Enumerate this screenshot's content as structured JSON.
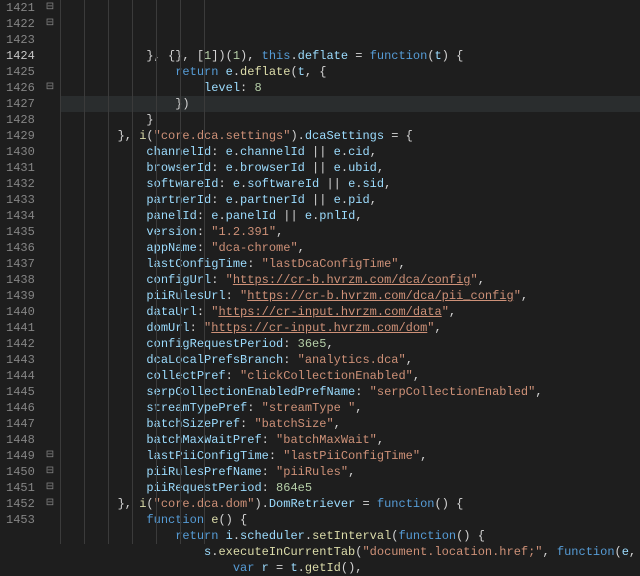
{
  "editor": {
    "currentLine": 1424,
    "indentWidth": 24,
    "lines": [
      {
        "num": 1421,
        "fold": "open",
        "indent": 3,
        "tokens": [
          [
            "p",
            "}, {}, ["
          ],
          [
            "n",
            "1"
          ],
          [
            "p",
            "])("
          ],
          [
            "n",
            "1"
          ],
          [
            "p",
            "), "
          ],
          [
            "k",
            "this"
          ],
          [
            "p",
            "."
          ],
          [
            "i",
            "deflate"
          ],
          [
            "p",
            " = "
          ],
          [
            "k",
            "function"
          ],
          [
            "p",
            "("
          ],
          [
            "i",
            "t"
          ],
          [
            "p",
            ") {"
          ]
        ]
      },
      {
        "num": 1422,
        "fold": "open",
        "indent": 4,
        "tokens": [
          [
            "k",
            "return"
          ],
          [
            "p",
            " "
          ],
          [
            "i",
            "e"
          ],
          [
            "p",
            "."
          ],
          [
            "f",
            "deflate"
          ],
          [
            "p",
            "("
          ],
          [
            "i",
            "t"
          ],
          [
            "p",
            ", {"
          ]
        ]
      },
      {
        "num": 1423,
        "fold": "",
        "indent": 5,
        "tokens": [
          [
            "i",
            "level"
          ],
          [
            "p",
            ": "
          ],
          [
            "n",
            "8"
          ]
        ]
      },
      {
        "num": 1424,
        "fold": "",
        "indent": 4,
        "tokens": [
          [
            "p",
            "})"
          ]
        ]
      },
      {
        "num": 1425,
        "fold": "",
        "indent": 3,
        "tokens": [
          [
            "p",
            "}"
          ]
        ]
      },
      {
        "num": 1426,
        "fold": "open",
        "indent": 2,
        "tokens": [
          [
            "p",
            "}, "
          ],
          [
            "f",
            "i"
          ],
          [
            "p",
            "("
          ],
          [
            "s",
            "\"core.dca.settings\""
          ],
          [
            "p",
            ")."
          ],
          [
            "i",
            "dcaSettings"
          ],
          [
            "p",
            " = {"
          ]
        ]
      },
      {
        "num": 1427,
        "fold": "",
        "indent": 3,
        "tokens": [
          [
            "i",
            "channelId"
          ],
          [
            "p",
            ": "
          ],
          [
            "i",
            "e"
          ],
          [
            "p",
            "."
          ],
          [
            "i",
            "channelId"
          ],
          [
            "p",
            " || "
          ],
          [
            "i",
            "e"
          ],
          [
            "p",
            "."
          ],
          [
            "i",
            "cid"
          ],
          [
            "p",
            ","
          ]
        ]
      },
      {
        "num": 1428,
        "fold": "",
        "indent": 3,
        "tokens": [
          [
            "i",
            "browserId"
          ],
          [
            "p",
            ": "
          ],
          [
            "i",
            "e"
          ],
          [
            "p",
            "."
          ],
          [
            "i",
            "browserId"
          ],
          [
            "p",
            " || "
          ],
          [
            "i",
            "e"
          ],
          [
            "p",
            "."
          ],
          [
            "i",
            "ubid"
          ],
          [
            "p",
            ","
          ]
        ]
      },
      {
        "num": 1429,
        "fold": "",
        "indent": 3,
        "tokens": [
          [
            "i",
            "softwareId"
          ],
          [
            "p",
            ": "
          ],
          [
            "i",
            "e"
          ],
          [
            "p",
            "."
          ],
          [
            "i",
            "softwareId"
          ],
          [
            "p",
            " || "
          ],
          [
            "i",
            "e"
          ],
          [
            "p",
            "."
          ],
          [
            "i",
            "sid"
          ],
          [
            "p",
            ","
          ]
        ]
      },
      {
        "num": 1430,
        "fold": "",
        "indent": 3,
        "tokens": [
          [
            "i",
            "partnerId"
          ],
          [
            "p",
            ": "
          ],
          [
            "i",
            "e"
          ],
          [
            "p",
            "."
          ],
          [
            "i",
            "partnerId"
          ],
          [
            "p",
            " || "
          ],
          [
            "i",
            "e"
          ],
          [
            "p",
            "."
          ],
          [
            "i",
            "pid"
          ],
          [
            "p",
            ","
          ]
        ]
      },
      {
        "num": 1431,
        "fold": "",
        "indent": 3,
        "tokens": [
          [
            "i",
            "panelId"
          ],
          [
            "p",
            ": "
          ],
          [
            "i",
            "e"
          ],
          [
            "p",
            "."
          ],
          [
            "i",
            "panelId"
          ],
          [
            "p",
            " || "
          ],
          [
            "i",
            "e"
          ],
          [
            "p",
            "."
          ],
          [
            "i",
            "pnlId"
          ],
          [
            "p",
            ","
          ]
        ]
      },
      {
        "num": 1432,
        "fold": "",
        "indent": 3,
        "tokens": [
          [
            "i",
            "version"
          ],
          [
            "p",
            ": "
          ],
          [
            "s",
            "\"1.2.391\""
          ],
          [
            "p",
            ","
          ]
        ]
      },
      {
        "num": 1433,
        "fold": "",
        "indent": 3,
        "tokens": [
          [
            "i",
            "appName"
          ],
          [
            "p",
            ": "
          ],
          [
            "s",
            "\"dca-chrome\""
          ],
          [
            "p",
            ","
          ]
        ]
      },
      {
        "num": 1434,
        "fold": "",
        "indent": 3,
        "tokens": [
          [
            "i",
            "lastConfigTime"
          ],
          [
            "p",
            ": "
          ],
          [
            "s",
            "\"lastDcaConfigTime\""
          ],
          [
            "p",
            ","
          ]
        ]
      },
      {
        "num": 1435,
        "fold": "",
        "indent": 3,
        "tokens": [
          [
            "i",
            "configUrl"
          ],
          [
            "p",
            ": "
          ],
          [
            "s",
            "\""
          ],
          [
            "su",
            "https://cr-b.hvrzm.com/dca/config"
          ],
          [
            "s",
            "\""
          ],
          [
            "p",
            ","
          ]
        ]
      },
      {
        "num": 1436,
        "fold": "",
        "indent": 3,
        "tokens": [
          [
            "i",
            "piiRulesUrl"
          ],
          [
            "p",
            ": "
          ],
          [
            "s",
            "\""
          ],
          [
            "su",
            "https://cr-b.hvrzm.com/dca/pii_config"
          ],
          [
            "s",
            "\""
          ],
          [
            "p",
            ","
          ]
        ]
      },
      {
        "num": 1437,
        "fold": "",
        "indent": 3,
        "tokens": [
          [
            "i",
            "dataUrl"
          ],
          [
            "p",
            ": "
          ],
          [
            "s",
            "\""
          ],
          [
            "su",
            "https://cr-input.hvrzm.com/data"
          ],
          [
            "s",
            "\""
          ],
          [
            "p",
            ","
          ]
        ]
      },
      {
        "num": 1438,
        "fold": "",
        "indent": 3,
        "tokens": [
          [
            "i",
            "domUrl"
          ],
          [
            "p",
            ": "
          ],
          [
            "s",
            "\""
          ],
          [
            "su",
            "https://cr-input.hvrzm.com/dom"
          ],
          [
            "s",
            "\""
          ],
          [
            "p",
            ","
          ]
        ]
      },
      {
        "num": 1439,
        "fold": "",
        "indent": 3,
        "tokens": [
          [
            "i",
            "configRequestPeriod"
          ],
          [
            "p",
            ": "
          ],
          [
            "n",
            "36e5"
          ],
          [
            "p",
            ","
          ]
        ]
      },
      {
        "num": 1440,
        "fold": "",
        "indent": 3,
        "tokens": [
          [
            "i",
            "dcaLocalPrefsBranch"
          ],
          [
            "p",
            ": "
          ],
          [
            "s",
            "\"analytics.dca\""
          ],
          [
            "p",
            ","
          ]
        ]
      },
      {
        "num": 1441,
        "fold": "",
        "indent": 3,
        "tokens": [
          [
            "i",
            "collectPref"
          ],
          [
            "p",
            ": "
          ],
          [
            "s",
            "\"clickCollectionEnabled\""
          ],
          [
            "p",
            ","
          ]
        ]
      },
      {
        "num": 1442,
        "fold": "",
        "indent": 3,
        "tokens": [
          [
            "i",
            "serpCollectionEnabledPrefName"
          ],
          [
            "p",
            ": "
          ],
          [
            "s",
            "\"serpCollectionEnabled\""
          ],
          [
            "p",
            ","
          ]
        ]
      },
      {
        "num": 1443,
        "fold": "",
        "indent": 3,
        "tokens": [
          [
            "i",
            "streamTypePref"
          ],
          [
            "p",
            ": "
          ],
          [
            "s",
            "\"streamType \""
          ],
          [
            "p",
            ","
          ]
        ]
      },
      {
        "num": 1444,
        "fold": "",
        "indent": 3,
        "tokens": [
          [
            "i",
            "batchSizePref"
          ],
          [
            "p",
            ": "
          ],
          [
            "s",
            "\"batchSize\""
          ],
          [
            "p",
            ","
          ]
        ]
      },
      {
        "num": 1445,
        "fold": "",
        "indent": 3,
        "tokens": [
          [
            "i",
            "batchMaxWaitPref"
          ],
          [
            "p",
            ": "
          ],
          [
            "s",
            "\"batchMaxWait\""
          ],
          [
            "p",
            ","
          ]
        ]
      },
      {
        "num": 1446,
        "fold": "",
        "indent": 3,
        "tokens": [
          [
            "i",
            "lastPiiConfigTime"
          ],
          [
            "p",
            ": "
          ],
          [
            "s",
            "\"lastPiiConfigTime\""
          ],
          [
            "p",
            ","
          ]
        ]
      },
      {
        "num": 1447,
        "fold": "",
        "indent": 3,
        "tokens": [
          [
            "i",
            "piiRulesPrefName"
          ],
          [
            "p",
            ": "
          ],
          [
            "s",
            "\"piiRules\""
          ],
          [
            "p",
            ","
          ]
        ]
      },
      {
        "num": 1448,
        "fold": "",
        "indent": 3,
        "tokens": [
          [
            "i",
            "piiRequestPeriod"
          ],
          [
            "p",
            ": "
          ],
          [
            "n",
            "864e5"
          ]
        ]
      },
      {
        "num": 1449,
        "fold": "open",
        "indent": 2,
        "tokens": [
          [
            "p",
            "}, "
          ],
          [
            "f",
            "i"
          ],
          [
            "p",
            "("
          ],
          [
            "s",
            "\"core.dca.dom\""
          ],
          [
            "p",
            ")."
          ],
          [
            "i",
            "DomRetriever"
          ],
          [
            "p",
            " = "
          ],
          [
            "k",
            "function"
          ],
          [
            "p",
            "() {"
          ]
        ]
      },
      {
        "num": 1450,
        "fold": "open",
        "indent": 3,
        "tokens": [
          [
            "k",
            "function"
          ],
          [
            "p",
            " "
          ],
          [
            "f",
            "e"
          ],
          [
            "p",
            "() {"
          ]
        ]
      },
      {
        "num": 1451,
        "fold": "open",
        "indent": 4,
        "tokens": [
          [
            "k",
            "return"
          ],
          [
            "p",
            " "
          ],
          [
            "i",
            "i"
          ],
          [
            "p",
            "."
          ],
          [
            "i",
            "scheduler"
          ],
          [
            "p",
            "."
          ],
          [
            "f",
            "setInterval"
          ],
          [
            "p",
            "("
          ],
          [
            "k",
            "function"
          ],
          [
            "p",
            "() {"
          ]
        ]
      },
      {
        "num": 1452,
        "fold": "open",
        "indent": 5,
        "tokens": [
          [
            "i",
            "s"
          ],
          [
            "p",
            "."
          ],
          [
            "f",
            "executeInCurrentTab"
          ],
          [
            "p",
            "("
          ],
          [
            "s",
            "\"document.location.href;\""
          ],
          [
            "p",
            ", "
          ],
          [
            "k",
            "function"
          ],
          [
            "p",
            "("
          ],
          [
            "i",
            "e"
          ],
          [
            "p",
            ", "
          ],
          [
            "i",
            "t"
          ],
          [
            "p",
            ") {"
          ]
        ]
      },
      {
        "num": 1453,
        "fold": "",
        "indent": 6,
        "tokens": [
          [
            "k",
            "var"
          ],
          [
            "p",
            " "
          ],
          [
            "i",
            "r"
          ],
          [
            "p",
            " = "
          ],
          [
            "i",
            "t"
          ],
          [
            "p",
            "."
          ],
          [
            "f",
            "getId"
          ],
          [
            "p",
            "(),"
          ]
        ]
      }
    ]
  }
}
